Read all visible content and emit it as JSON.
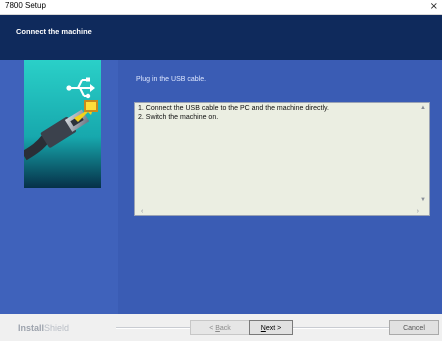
{
  "window": {
    "title": "7800 Setup",
    "close_glyph": "×"
  },
  "header": {
    "caption": "Connect the machine"
  },
  "main": {
    "plug_label": "Plug in the USB cable.",
    "instructions": [
      "1. Connect the USB cable to the PC and the machine directly.",
      "2. Switch the machine on."
    ],
    "illustration_icon": "usb-cable-icon"
  },
  "footer": {
    "brand_part1": "Install",
    "brand_part2": "Shield",
    "back_prefix": "< ",
    "back_underlined": "B",
    "back_rest": "ack",
    "next_underlined": "N",
    "next_rest": "ext >",
    "cancel_label": "Cancel"
  },
  "colors": {
    "header_bg": "#0f2a5c",
    "main_bg": "#3a5cb4",
    "textbox_bg": "#ebeee2",
    "illustration_teal": "#1ec3c0"
  }
}
